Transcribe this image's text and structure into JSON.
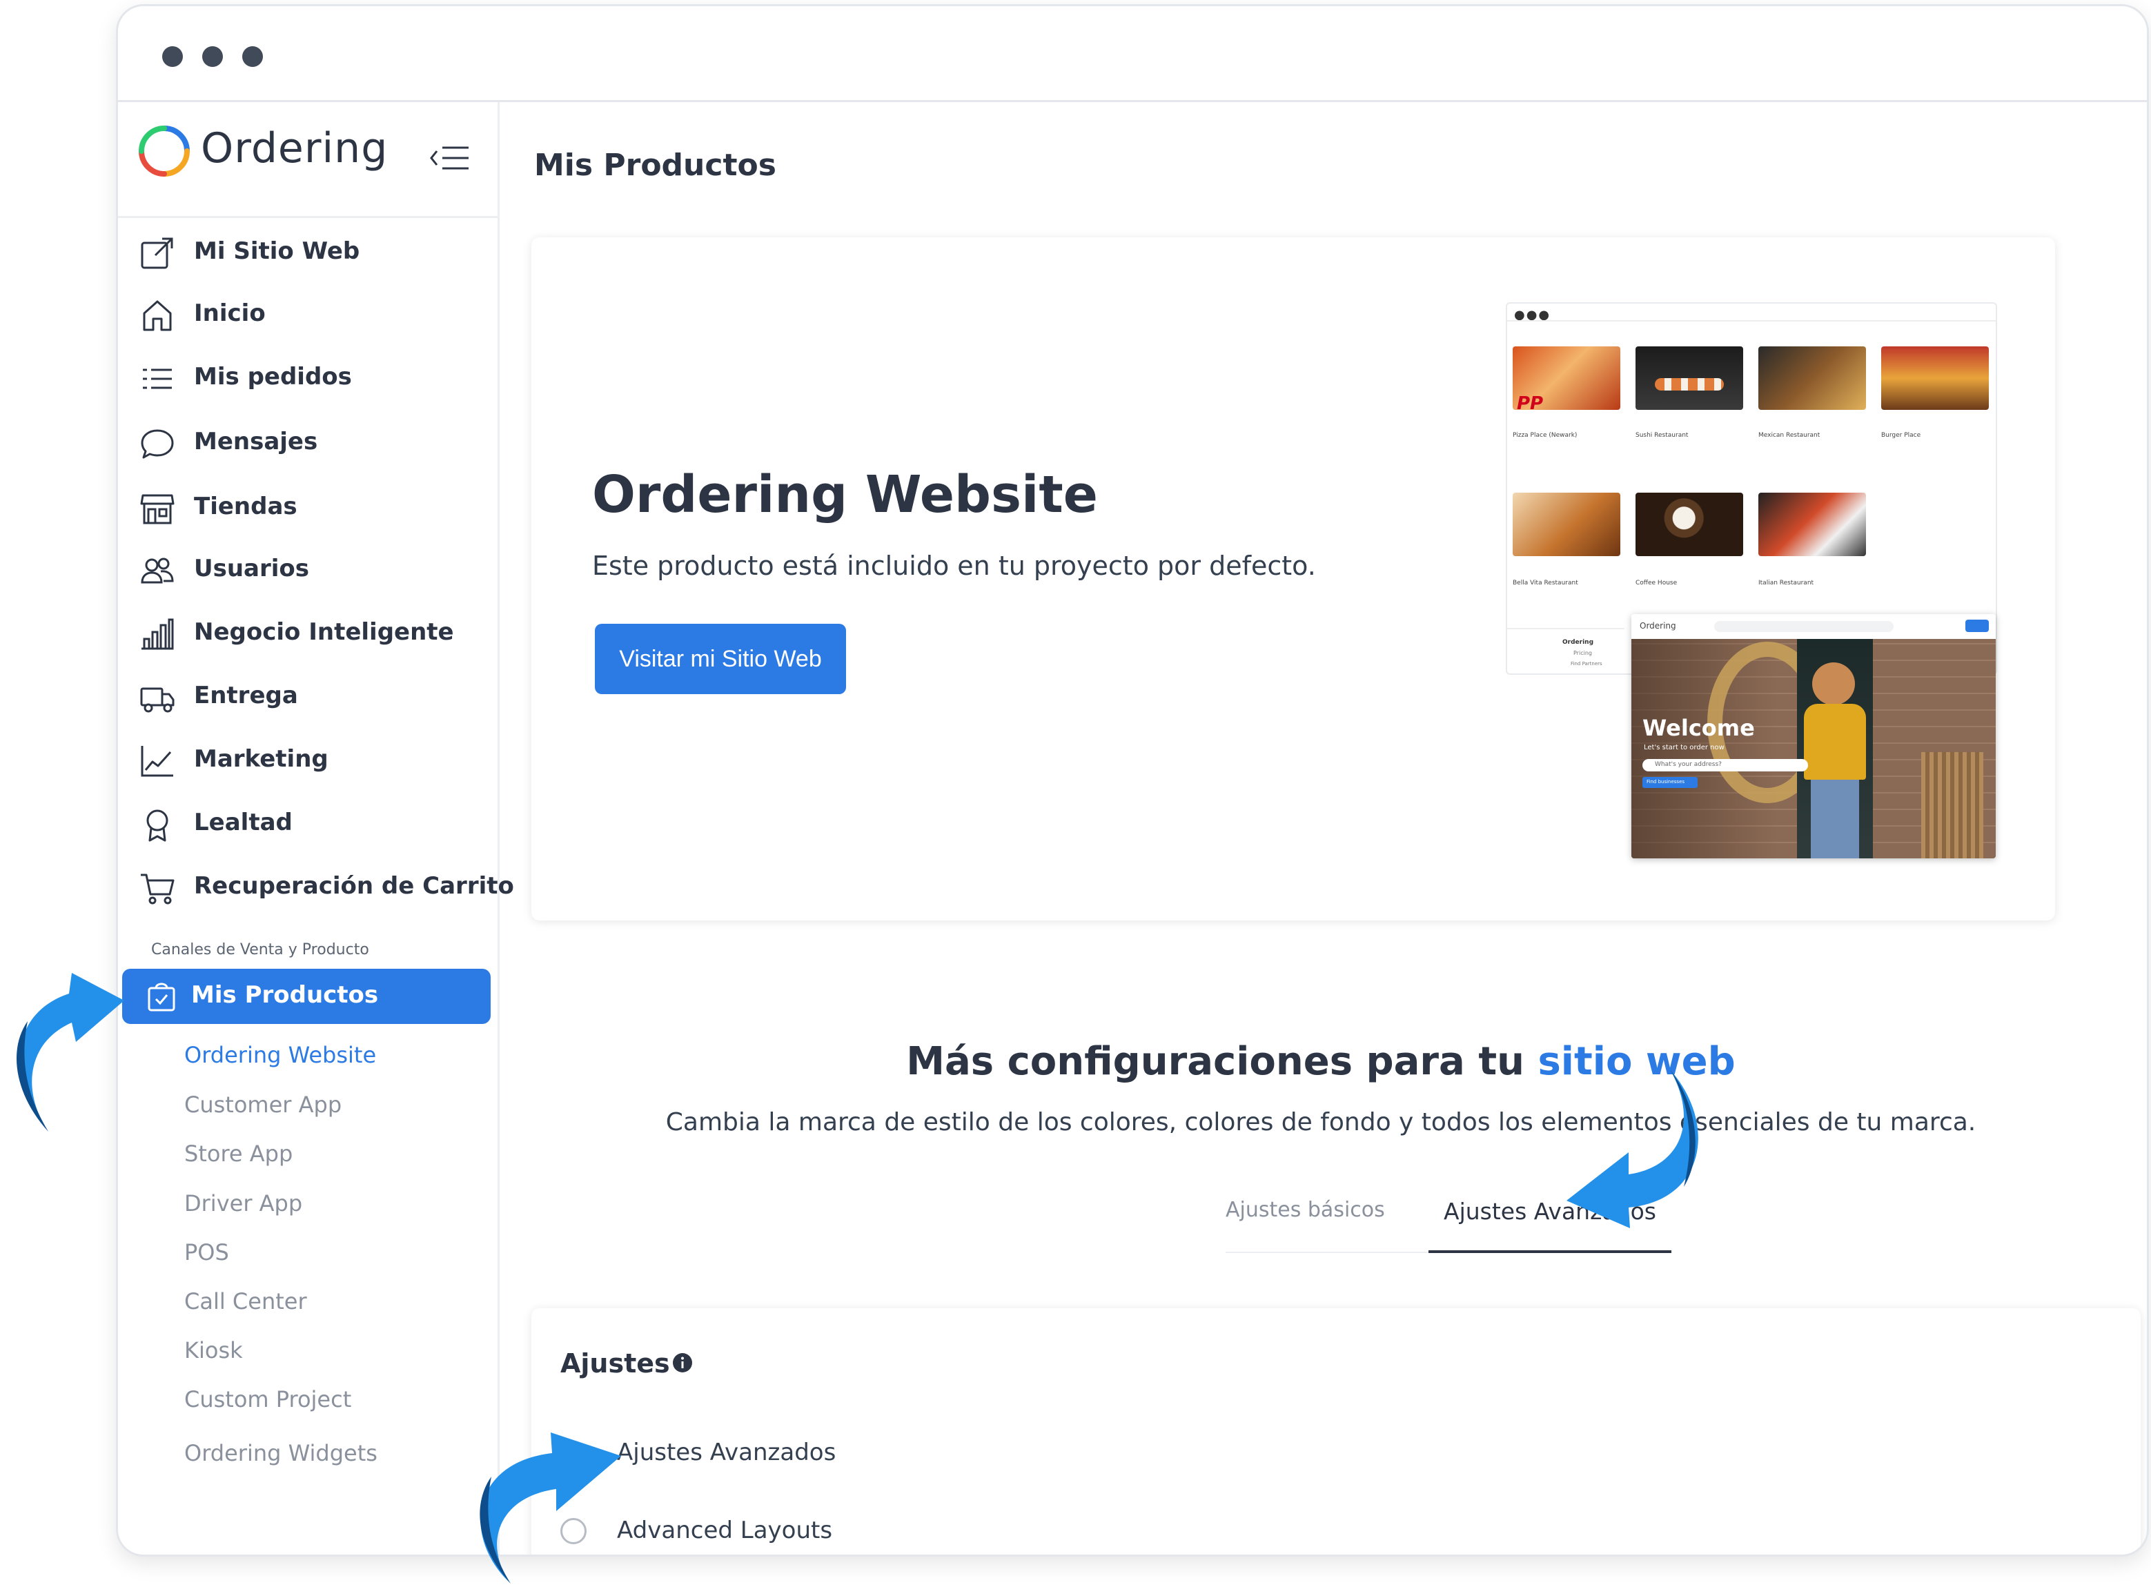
{
  "brand": {
    "name": "Ordering",
    "accent": "#2c7be5",
    "arrow_color": "#1e88e5"
  },
  "sidebar": {
    "items": [
      {
        "label": "Mi Sitio Web",
        "icon": "external-link-icon"
      },
      {
        "label": "Inicio",
        "icon": "home-icon"
      },
      {
        "label": "Mis pedidos",
        "icon": "list-icon"
      },
      {
        "label": "Mensajes",
        "icon": "chat-bubble-icon"
      },
      {
        "label": "Tiendas",
        "icon": "shop-icon"
      },
      {
        "label": "Usuarios",
        "icon": "users-icon"
      },
      {
        "label": "Negocio Inteligente",
        "icon": "bar-chart-icon"
      },
      {
        "label": "Entrega",
        "icon": "truck-icon"
      },
      {
        "label": "Marketing",
        "icon": "line-chart-icon"
      },
      {
        "label": "Lealtad",
        "icon": "award-icon"
      },
      {
        "label": "Recuperación de Carrito",
        "icon": "cart-icon"
      }
    ],
    "section_label": "Canales de Venta y Producto",
    "active_item": {
      "label": "Mis Productos",
      "icon": "shopping-bag-check-icon"
    },
    "sub_items": [
      {
        "label": "Ordering Website",
        "active": true
      },
      {
        "label": "Customer App",
        "active": false
      },
      {
        "label": "Store App",
        "active": false
      },
      {
        "label": "Driver App",
        "active": false
      },
      {
        "label": "POS",
        "active": false
      },
      {
        "label": "Call Center",
        "active": false
      },
      {
        "label": "Kiosk",
        "active": false
      },
      {
        "label": "Custom Project",
        "active": false
      },
      {
        "label": "Ordering Widgets",
        "active": false
      }
    ]
  },
  "main": {
    "title": "Mis Productos",
    "product_card": {
      "title": "Ordering Website",
      "description": "Este producto está incluido en tu proyecto por defecto.",
      "button_label": "Visitar mi Sitio Web",
      "preview": {
        "restaurants": [
          "Pizza Place (Newark)",
          "Sushi Restaurant",
          "Mexican Restaurant",
          "Burger Place",
          "Bella Vita Restaurant",
          "Coffee House",
          "Italian Restaurant"
        ],
        "welcome_heading": "Welcome",
        "welcome_sub": "Let's start to order now",
        "address_placeholder": "What's your address?",
        "find_button": "Find businesses",
        "mini_brand": "Ordering",
        "mini_footer": [
          "Ordering",
          "Pricing",
          "Find Partners"
        ]
      }
    },
    "more_config": {
      "title_prefix": "Más configuraciones para tu ",
      "title_accent": "sitio web",
      "description": "Cambia la marca de estilo de los colores, colores de fondo y todos los elementos esenciales de tu marca."
    },
    "tabs": [
      {
        "label": "Ajustes básicos",
        "active": false
      },
      {
        "label": "Ajustes Avanzados",
        "active": true
      }
    ],
    "settings": {
      "title": "Ajustes",
      "options": [
        {
          "label": "Ajustes Avanzados",
          "checked": false
        },
        {
          "label": "Advanced Layouts",
          "checked": false
        }
      ]
    }
  }
}
